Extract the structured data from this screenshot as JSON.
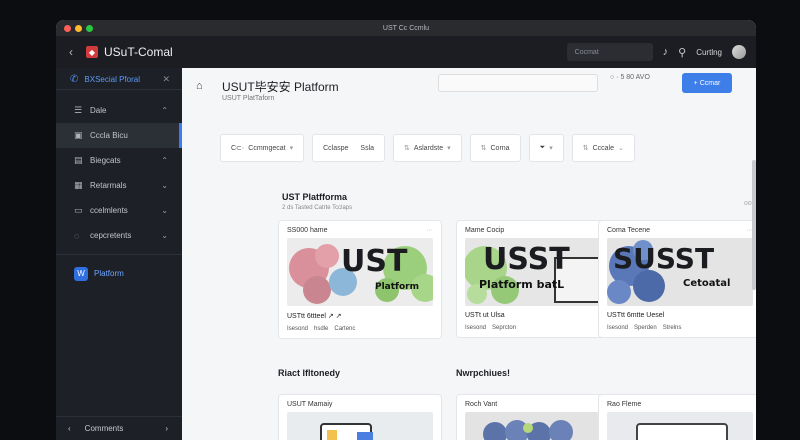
{
  "window": {
    "title": "UST Cc Ccmlu",
    "traffic_colors": [
      "#ff5f57",
      "#febc2e",
      "#28c840"
    ]
  },
  "appbar": {
    "back_icon": "chevron-left-icon",
    "logo_icon": "shield-logo-icon",
    "app_name": "USuT-Comal",
    "search_placeholder": "Cocmat",
    "bell_icon": "bell-icon",
    "share_icon": "share-icon",
    "user_name": "Curtlng"
  },
  "sidebar": {
    "header_label": "BXSecial Pforal",
    "items": [
      {
        "label": "Dale",
        "icon": "list-icon",
        "chevron": "⌃"
      },
      {
        "label": "Cccla Bicu",
        "icon": "folder-icon",
        "chevron": ""
      },
      {
        "label": "Biegcats",
        "icon": "book-icon",
        "chevron": "⌃"
      },
      {
        "label": "Retarmals",
        "icon": "grid-icon",
        "chevron": "⌄"
      },
      {
        "label": "ccelmlents",
        "icon": "folder-icon",
        "chevron": "⌄"
      },
      {
        "label": "cepcretents",
        "icon": "chat-icon",
        "chevron": "⌄"
      },
      {
        "label": "Platform",
        "icon": "platform-icon",
        "chevron": ""
      }
    ],
    "footer_label": "Comments"
  },
  "header": {
    "title": "USUT毕安安 Platform",
    "subtitle": "USUT PlatTaforn",
    "status": "○ · 5 80 AVO",
    "primary_button": "+ Ccmar"
  },
  "filters": [
    {
      "label": "Ccmmgecat",
      "prefix": "C⊂·"
    },
    {
      "label": "Cclaspe",
      "extra": "Ssla"
    },
    {
      "label": "Aslardste"
    },
    {
      "label": "Corna"
    },
    {
      "label": "Cccale"
    }
  ],
  "section1": {
    "title": "UST Platfforma",
    "meta": "2 ds   Tasted   Catrte Tcclaps",
    "more": "oo",
    "cards": [
      {
        "title": "SS000 hame",
        "caption": "USTtt 6ttteel  ↗ ↗",
        "tags": [
          "Isesond",
          "hsdle",
          "Cartenc"
        ],
        "thumb_big": "UST",
        "thumb_small": "Platform"
      },
      {
        "title": "Mame Cocip",
        "caption": "USTt ut Ulsa",
        "tags": [
          "Isesond",
          "Seprcton"
        ],
        "thumb_big": "USST",
        "thumb_small": "Platform batL"
      },
      {
        "title": "Coma Tecene",
        "caption": "USTtt 6mtte Uesel",
        "tags": [
          "Isesond",
          "Sperden",
          "Strelns"
        ],
        "thumb_big": "SUSST",
        "thumb_small": "Cetoatal"
      }
    ]
  },
  "section2": {
    "left_title": "Riact lfltonedy",
    "right_title": "Nwrpchiues!",
    "cards": [
      {
        "title": "USUT Mamaiy"
      },
      {
        "title": "Roch Vant"
      },
      {
        "title": "Rao Fleme"
      }
    ]
  }
}
